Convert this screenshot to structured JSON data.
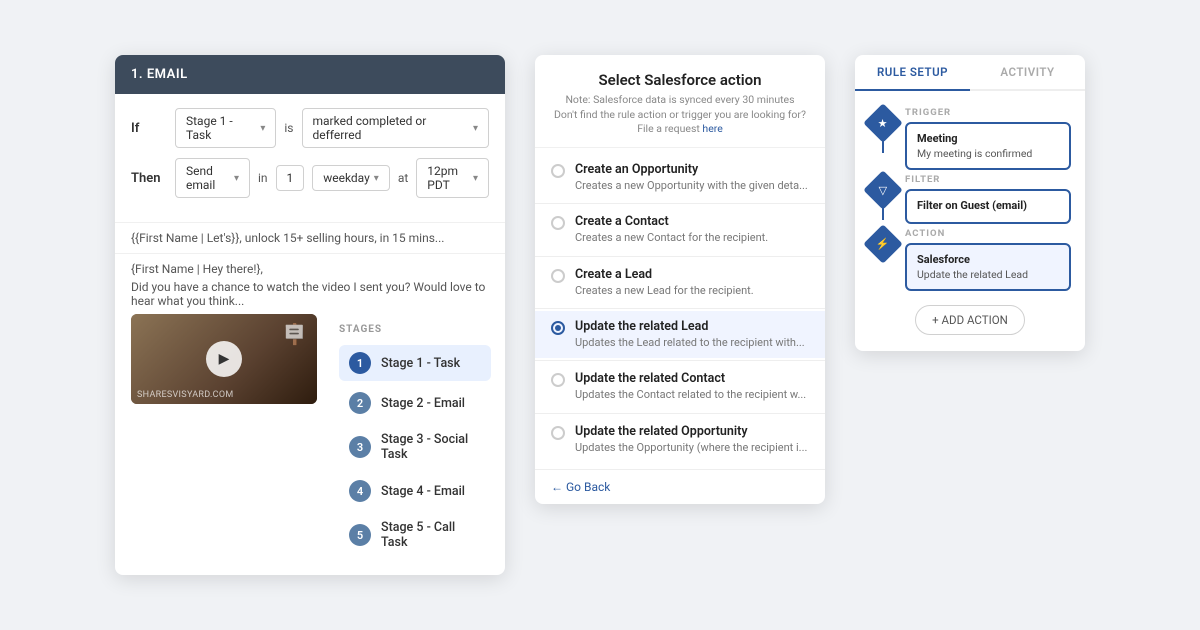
{
  "left_panel": {
    "header": "1. EMAIL",
    "if_label": "If",
    "then_label": "Then",
    "condition_stage": "Stage 1 - Task",
    "condition_is": "is",
    "condition_value": "marked completed or defferred",
    "action_send": "Send email",
    "action_in": "in",
    "action_number": "1",
    "action_unit": "weekday",
    "action_at": "at",
    "action_time": "12pm PDT",
    "email_subject": "{{First Name | Let's}}, unlock 15+ selling hours, in 15 mins...",
    "email_body": "{First Name | Hey there!},\n\nDid you have a chance to watch the video I sent you? Would love to hear what you think...",
    "video_watermark": "SHARESVISYARD.COM",
    "stages_title": "STAGES",
    "stages": [
      {
        "num": "1",
        "name": "Stage 1 - Task",
        "active": true
      },
      {
        "num": "2",
        "name": "Stage 2 - Email",
        "active": false
      },
      {
        "num": "3",
        "name": "Stage 3 - Social Task",
        "active": false
      },
      {
        "num": "4",
        "name": "Stage 4 - Email",
        "active": false
      },
      {
        "num": "5",
        "name": "Stage 5 - Call Task",
        "active": false
      }
    ]
  },
  "middle_panel": {
    "title": "Select Salesforce action",
    "note": "Note: Salesforce data is synced every 30 minutes",
    "note2": "Don't find the rule action or trigger you are looking for? File a request",
    "note_link": "here",
    "options": [
      {
        "id": "create-opportunity",
        "title": "Create an Opportunity",
        "desc": "Creates a new Opportunity with the given deta...",
        "selected": false
      },
      {
        "id": "create-contact",
        "title": "Create a Contact",
        "desc": "Creates a new Contact for the recipient.",
        "selected": false
      },
      {
        "id": "create-lead",
        "title": "Create a Lead",
        "desc": "Creates a new Lead for the recipient.",
        "selected": false
      },
      {
        "id": "update-related-lead",
        "title": "Update the related Lead",
        "desc": "Updates the Lead related to the recipient with...",
        "selected": true
      },
      {
        "id": "update-related-contact",
        "title": "Update the related Contact",
        "desc": "Updates the Contact related to the recipient w...",
        "selected": false
      },
      {
        "id": "update-related-opportunity",
        "title": "Update the related Opportunity",
        "desc": "Updates the Opportunity (where the recipient i...",
        "selected": false
      }
    ],
    "back_label": "← Go Back"
  },
  "right_panel": {
    "tabs": [
      {
        "id": "rule-setup",
        "label": "RULE SETUP",
        "active": true
      },
      {
        "id": "activity",
        "label": "ACTIVITY",
        "active": false
      }
    ],
    "trigger_label": "TRIGGER",
    "trigger_title": "Meeting",
    "trigger_sub": "My meeting is confirmed",
    "filter_label": "FILTER",
    "filter_title": "Filter on Guest (email)",
    "action_label": "ACTION",
    "action_title": "Salesforce",
    "action_sub": "Update the related Lead",
    "add_action_label": "+ ADD ACTION"
  }
}
